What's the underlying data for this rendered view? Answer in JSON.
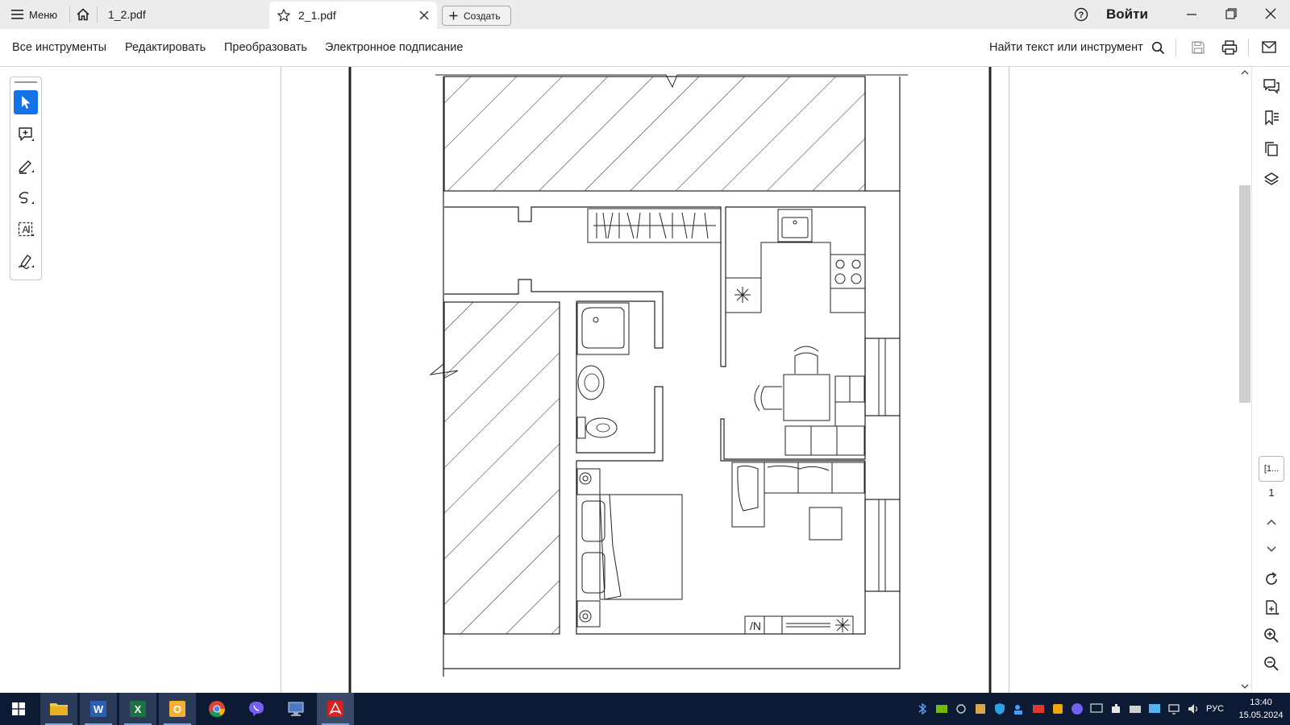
{
  "titlebar": {
    "menu_label": "Меню",
    "tabs": [
      {
        "label": "1_2.pdf"
      },
      {
        "label": "2_1.pdf"
      }
    ],
    "create_label": "Создать",
    "signin_label": "Войти"
  },
  "toolbar": {
    "all_tools": "Все инструменты",
    "edit": "Редактировать",
    "convert": "Преобразовать",
    "esign": "Электронное подписание",
    "search_label": "Найти текст или инструмент"
  },
  "rightrail": {
    "page_box": "[1...",
    "page_number": "1"
  },
  "taskbar": {
    "time": "13:40",
    "date": "15.05.2024",
    "lang": "РУС"
  },
  "colors": {
    "accent": "#1473e6",
    "titlebar_bg": "#ececec",
    "taskbar_bg": "#0d1a33"
  }
}
